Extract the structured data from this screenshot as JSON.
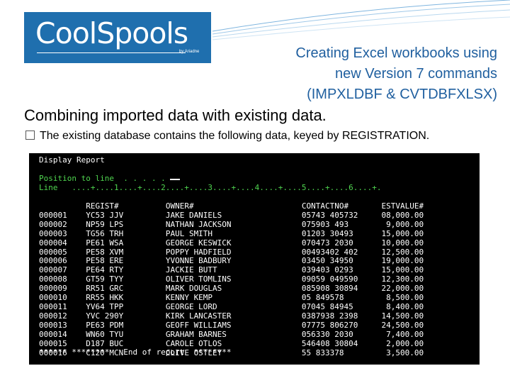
{
  "brand": {
    "logo_text": "CoolSpools",
    "logo_by": "by Ariadne",
    "colors": {
      "logo_bg": "#1f6fae",
      "title": "#1f5f9f",
      "terminal_bg": "#000000",
      "terminal_green": "#4fd44f",
      "terminal_white": "#ffffff"
    }
  },
  "slide": {
    "title": "Creating Excel workbooks using\nnew Version 7 commands\n(IMPXLDBF & CVTDBFXLSX)",
    "subtitle": "Combining imported data with existing data.",
    "bullet_icon": "checkbox-bullet-icon",
    "bullet": "The existing database contains the following data, keyed by REGISTRATION."
  },
  "terminal": {
    "title": "Display Report",
    "position_line": "Position to line  . . . . .",
    "ruler": "Line   ....+....1....+....2....+....3....+....4....+....5....+....6....+.",
    "headers": {
      "regist": "REGIST#",
      "owner": "OWNER#",
      "contact": "CONTACTNO#",
      "estvalue": "ESTVALUE#"
    },
    "rows": [
      {
        "line": "000001",
        "regist": "YC53 JJV",
        "owner": "JAKE DANIELS",
        "contact": "05743 405732",
        "value": "08,000.00"
      },
      {
        "line": "000002",
        "regist": "NP59 LPS",
        "owner": "NATHAN JACKSON",
        "contact": "075903 493",
        "value": "9,000.00"
      },
      {
        "line": "000003",
        "regist": "TG56 TRH",
        "owner": "PAUL SMITH",
        "contact": "01203 30493",
        "value": "15,000.00"
      },
      {
        "line": "000004",
        "regist": "PE61 WSA",
        "owner": "GEORGE KESWICK",
        "contact": "070473 2030",
        "value": "10,000.00"
      },
      {
        "line": "000005",
        "regist": "PE58 XVM",
        "owner": "POPPY HADFIELD",
        "contact": "00493402 402",
        "value": "12,500.00"
      },
      {
        "line": "000006",
        "regist": "PE58 ERE",
        "owner": "YVONNE BADBURY",
        "contact": "03450 34950",
        "value": "19,000.00"
      },
      {
        "line": "000007",
        "regist": "PE64 RTY",
        "owner": "JACKIE BUTT",
        "contact": "039403 0293",
        "value": "15,000.00"
      },
      {
        "line": "000008",
        "regist": "GT59 TYY",
        "owner": "OLIVER TOMLINS",
        "contact": "09059 049590",
        "value": "12,300.00"
      },
      {
        "line": "000009",
        "regist": "RR51 GRC",
        "owner": "MARK DOUGLAS",
        "contact": "085908 30894",
        "value": "22,000.00"
      },
      {
        "line": "000010",
        "regist": "RR55 HKK",
        "owner": "KENNY KEMP",
        "contact": "05 849578",
        "value": "8,500.00"
      },
      {
        "line": "000011",
        "regist": "YV64 TPP",
        "owner": "GEORGE LORD",
        "contact": "07045 84945",
        "value": "8,400.00"
      },
      {
        "line": "000012",
        "regist": "YVC 290Y",
        "owner": "KIRK LANCASTER",
        "contact": "0387938 2398",
        "value": "14,500.00"
      },
      {
        "line": "000013",
        "regist": "PE63 PDM",
        "owner": "GEOFF WILLIAMS",
        "contact": "07775 806270",
        "value": "24,500.00"
      },
      {
        "line": "000014",
        "regist": "WN60 TYU",
        "owner": "GRAHAM BARNES",
        "contact": "056330 2030",
        "value": "7,400.00"
      },
      {
        "line": "000015",
        "regist": "D187 BUC",
        "owner": "CAROLE OTLOS",
        "contact": "546408 30804",
        "value": "2,000.00"
      },
      {
        "line": "000016",
        "regist": "C120 MCN",
        "owner": "CLIVE OSTLEY",
        "contact": "55 833378",
        "value": "3,500.00"
      }
    ],
    "footer": "****** ********   End of report  ********"
  }
}
